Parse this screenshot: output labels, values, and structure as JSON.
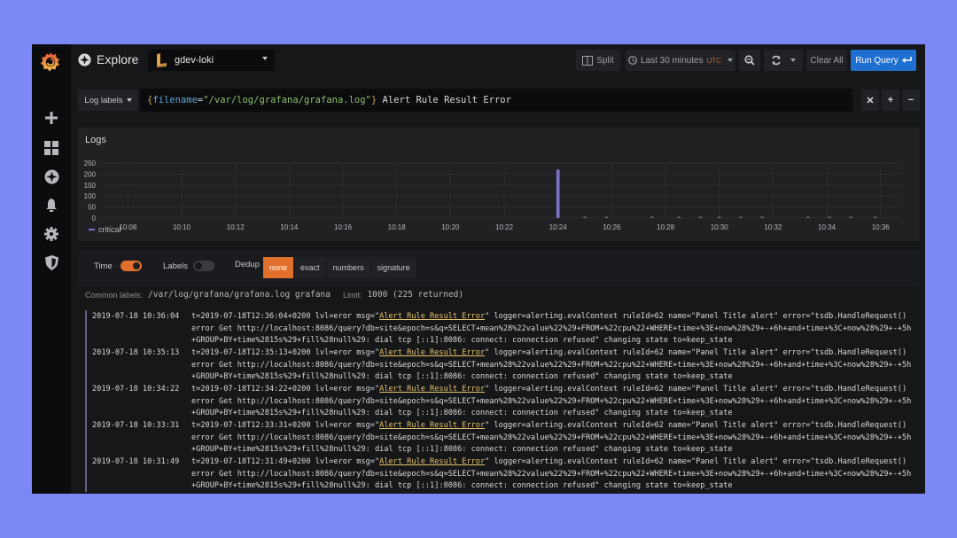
{
  "app": {
    "page_title": "Explore",
    "datasource": "gdev-loki"
  },
  "toolbar": {
    "split_label": "Split",
    "time_range_label": "Last 30 minutes",
    "timezone": "UTC",
    "clear_all_label": "Clear All",
    "run_query_label": "Run Query"
  },
  "query": {
    "log_labels_label": "Log labels",
    "brace_open": "{",
    "label_key": "filename",
    "label_op": "=",
    "label_value": "\"/var/log/grafana/grafana.log\"",
    "brace_close": "}",
    "search_text": " Alert Rule Result Error"
  },
  "panel": {
    "title": "Logs",
    "legend_label": "critical"
  },
  "chart_data": {
    "type": "bar",
    "title": "Logs",
    "xlabel": "",
    "ylabel": "",
    "ylim": [
      0,
      250
    ],
    "yticks": [
      "0",
      "50",
      "100",
      "150",
      "200",
      "250"
    ],
    "xticks": [
      "10:08",
      "10:10",
      "10:12",
      "10:14",
      "10:16",
      "10:18",
      "10:20",
      "10:22",
      "10:24",
      "10:26",
      "10:28",
      "10:30",
      "10:32",
      "10:34",
      "10:36"
    ],
    "x_range_minutes": [
      7.0,
      36.8
    ],
    "legend": "bottom-left",
    "grid": true,
    "series": [
      {
        "name": "critical",
        "color": "#7b73c9",
        "points": [
          {
            "x": "10:24",
            "x_min": 24.0,
            "y": 220
          },
          {
            "x": "10:25",
            "x_min": 25.0,
            "y": 1
          },
          {
            "x": "10:25",
            "x_min": 25.8,
            "y": 1
          },
          {
            "x": "10:27",
            "x_min": 27.5,
            "y": 1
          },
          {
            "x": "10:28",
            "x_min": 28.5,
            "y": 1
          },
          {
            "x": "10:29",
            "x_min": 29.3,
            "y": 1
          },
          {
            "x": "10:30",
            "x_min": 30.0,
            "y": 1
          },
          {
            "x": "10:30",
            "x_min": 30.8,
            "y": 1
          },
          {
            "x": "10:31",
            "x_min": 31.6,
            "y": 1
          },
          {
            "x": "10:33",
            "x_min": 33.3,
            "y": 1
          },
          {
            "x": "10:34",
            "x_min": 34.1,
            "y": 1
          },
          {
            "x": "10:34",
            "x_min": 34.9,
            "y": 1
          },
          {
            "x": "10:35",
            "x_min": 35.8,
            "y": 1
          }
        ]
      }
    ]
  },
  "options": {
    "time_label": "Time",
    "time_on": true,
    "labels_label": "Labels",
    "labels_on": false,
    "dedup_label": "Dedup",
    "dedup_options": [
      "none",
      "exact",
      "numbers",
      "signature"
    ],
    "dedup_selected": "none"
  },
  "meta": {
    "common_labels_label": "Common labels:",
    "common_labels_value": "/var/log/grafana/grafana.log grafana",
    "limit_label": "Limit:",
    "limit_value": "1000 (225 returned)"
  },
  "logs": [
    {
      "timestamp": "2019-07-18 10:36:04",
      "prefix": "t=2019-07-18T12:36:04+0200 lvl=eror msg=\"",
      "highlight": "Alert Rule Result Error",
      "suffix": "\" logger=alerting.evalContext ruleId=62 name=\"Panel Title alert\" error=\"tsdb.HandleRequest() error Get http://localhost:8086/query?db=site&epoch=s&q=SELECT+mean%28%22value%22%29+FROM+%22cpu%22+WHERE+time+%3E+now%28%29+-+6h+and+time+%3C+now%28%29+-+5h+GROUP+BY+time%2815s%29+fill%28null%29: dial tcp [::1]:8086: connect: connection refused\" changing state to=keep_state"
    },
    {
      "timestamp": "2019-07-18 10:35:13",
      "prefix": "t=2019-07-18T12:35:13+0200 lvl=eror msg=\"",
      "highlight": "Alert Rule Result Error",
      "suffix": "\" logger=alerting.evalContext ruleId=62 name=\"Panel Title alert\" error=\"tsdb.HandleRequest() error Get http://localhost:8086/query?db=site&epoch=s&q=SELECT+mean%28%22value%22%29+FROM+%22cpu%22+WHERE+time+%3E+now%28%29+-+6h+and+time+%3C+now%28%29+-+5h+GROUP+BY+time%2815s%29+fill%28null%29: dial tcp [::1]:8086: connect: connection refused\" changing state to=keep_state"
    },
    {
      "timestamp": "2019-07-18 10:34:22",
      "prefix": "t=2019-07-18T12:34:22+0200 lvl=eror msg=\"",
      "highlight": "Alert Rule Result Error",
      "suffix": "\" logger=alerting.evalContext ruleId=62 name=\"Panel Title alert\" error=\"tsdb.HandleRequest() error Get http://localhost:8086/query?db=site&epoch=s&q=SELECT+mean%28%22value%22%29+FROM+%22cpu%22+WHERE+time+%3E+now%28%29+-+6h+and+time+%3C+now%28%29+-+5h+GROUP+BY+time%2815s%29+fill%28null%29: dial tcp [::1]:8086: connect: connection refused\" changing state to=keep_state"
    },
    {
      "timestamp": "2019-07-18 10:33:31",
      "prefix": "t=2019-07-18T12:33:31+0200 lvl=eror msg=\"",
      "highlight": "Alert Rule Result Error",
      "suffix": "\" logger=alerting.evalContext ruleId=62 name=\"Panel Title alert\" error=\"tsdb.HandleRequest() error Get http://localhost:8086/query?db=site&epoch=s&q=SELECT+mean%28%22value%22%29+FROM+%22cpu%22+WHERE+time+%3E+now%28%29+-+6h+and+time+%3C+now%28%29+-+5h+GROUP+BY+time%2815s%29+fill%28null%29: dial tcp [::1]:8086: connect: connection refused\" changing state to=keep_state"
    },
    {
      "timestamp": "2019-07-18 10:31:49",
      "prefix": "t=2019-07-18T12:31:49+0200 lvl=eror msg=\"",
      "highlight": "Alert Rule Result Error",
      "suffix": "\" logger=alerting.evalContext ruleId=62 name=\"Panel Title alert\" error=\"tsdb.HandleRequest() error Get http://localhost:8086/query?db=site&epoch=s&q=SELECT+mean%28%22value%22%29+FROM+%22cpu%22+WHERE+time+%3E+now%28%29+-+6h+and+time+%3C+now%28%29+-+5h+GROUP+BY+time%2815s%29+fill%28null%29: dial tcp [::1]:8086: connect: connection refused\" changing state to=keep_state"
    }
  ],
  "colors": {
    "accent_orange": "#e0702c",
    "run_button_blue": "#1f6fd0",
    "highlight_yellow": "#e8c36a",
    "series_purple": "#7b73c9"
  }
}
